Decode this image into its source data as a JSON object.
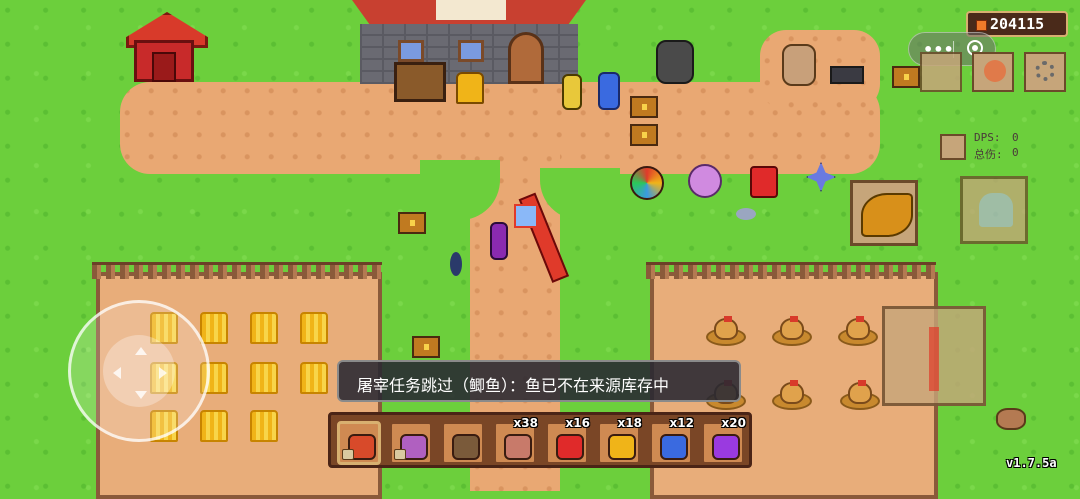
{
  "hud": {
    "currency_value": "204115",
    "stats": {
      "dps_label": "DPS:",
      "dps_value": "0",
      "damage_label": "总伤:",
      "damage_value": "0"
    },
    "version": "v1.7.5a"
  },
  "notification": {
    "text": "屠宰任务跳过（鲫鱼）：鱼已不在来源库存中"
  },
  "toolbar": {
    "slots": [
      {
        "icon": "pitchfork-tool-icon",
        "count": "",
        "locked": true,
        "color": "#d84a2a"
      },
      {
        "icon": "fish-tool-icon",
        "count": "",
        "locked": true,
        "color": "#b060c0"
      },
      {
        "icon": "scythe-tool-icon",
        "count": "",
        "locked": false,
        "color": "#7a5a3a"
      },
      {
        "icon": "meat-icon",
        "count": "x38",
        "locked": false,
        "color": "#c87a6a"
      },
      {
        "icon": "red-potion-icon",
        "count": "x16",
        "locked": false,
        "color": "#e02a2a"
      },
      {
        "icon": "yellow-potion-icon",
        "count": "x18",
        "locked": false,
        "color": "#f0b418"
      },
      {
        "icon": "blue-potion-icon",
        "count": "x12",
        "locked": false,
        "color": "#3a6ae0"
      },
      {
        "icon": "purple-potion-icon",
        "count": "x20",
        "locked": false,
        "color": "#9a3ae0"
      }
    ]
  },
  "colors": {
    "grass": "#6ccf3c",
    "path": "#e9a873",
    "fence": "#8a5a3a",
    "accent": "#d84a2a"
  }
}
